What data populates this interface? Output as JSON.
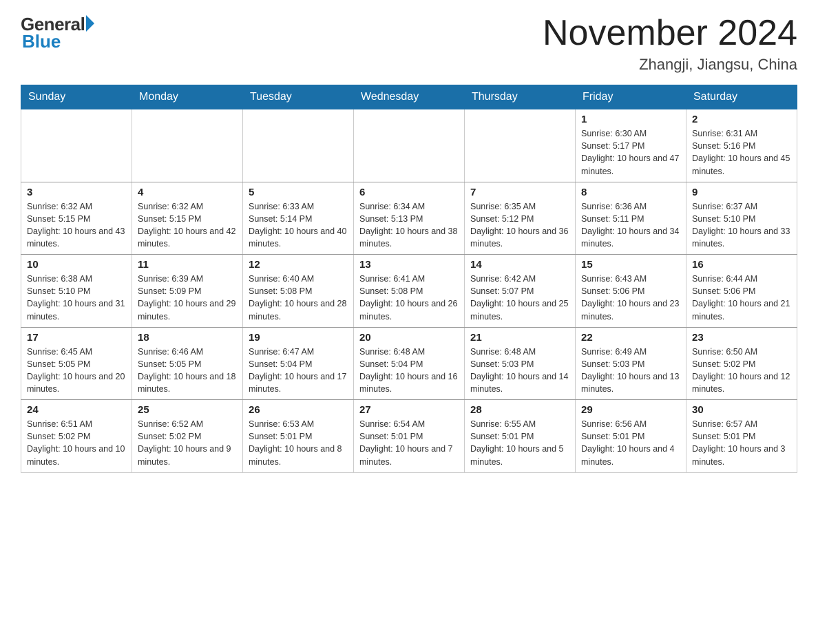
{
  "header": {
    "logo_general": "General",
    "logo_blue": "Blue",
    "month_title": "November 2024",
    "location": "Zhangji, Jiangsu, China"
  },
  "weekdays": [
    "Sunday",
    "Monday",
    "Tuesday",
    "Wednesday",
    "Thursday",
    "Friday",
    "Saturday"
  ],
  "weeks": [
    [
      {
        "day": "",
        "info": ""
      },
      {
        "day": "",
        "info": ""
      },
      {
        "day": "",
        "info": ""
      },
      {
        "day": "",
        "info": ""
      },
      {
        "day": "",
        "info": ""
      },
      {
        "day": "1",
        "info": "Sunrise: 6:30 AM\nSunset: 5:17 PM\nDaylight: 10 hours and 47 minutes."
      },
      {
        "day": "2",
        "info": "Sunrise: 6:31 AM\nSunset: 5:16 PM\nDaylight: 10 hours and 45 minutes."
      }
    ],
    [
      {
        "day": "3",
        "info": "Sunrise: 6:32 AM\nSunset: 5:15 PM\nDaylight: 10 hours and 43 minutes."
      },
      {
        "day": "4",
        "info": "Sunrise: 6:32 AM\nSunset: 5:15 PM\nDaylight: 10 hours and 42 minutes."
      },
      {
        "day": "5",
        "info": "Sunrise: 6:33 AM\nSunset: 5:14 PM\nDaylight: 10 hours and 40 minutes."
      },
      {
        "day": "6",
        "info": "Sunrise: 6:34 AM\nSunset: 5:13 PM\nDaylight: 10 hours and 38 minutes."
      },
      {
        "day": "7",
        "info": "Sunrise: 6:35 AM\nSunset: 5:12 PM\nDaylight: 10 hours and 36 minutes."
      },
      {
        "day": "8",
        "info": "Sunrise: 6:36 AM\nSunset: 5:11 PM\nDaylight: 10 hours and 34 minutes."
      },
      {
        "day": "9",
        "info": "Sunrise: 6:37 AM\nSunset: 5:10 PM\nDaylight: 10 hours and 33 minutes."
      }
    ],
    [
      {
        "day": "10",
        "info": "Sunrise: 6:38 AM\nSunset: 5:10 PM\nDaylight: 10 hours and 31 minutes."
      },
      {
        "day": "11",
        "info": "Sunrise: 6:39 AM\nSunset: 5:09 PM\nDaylight: 10 hours and 29 minutes."
      },
      {
        "day": "12",
        "info": "Sunrise: 6:40 AM\nSunset: 5:08 PM\nDaylight: 10 hours and 28 minutes."
      },
      {
        "day": "13",
        "info": "Sunrise: 6:41 AM\nSunset: 5:08 PM\nDaylight: 10 hours and 26 minutes."
      },
      {
        "day": "14",
        "info": "Sunrise: 6:42 AM\nSunset: 5:07 PM\nDaylight: 10 hours and 25 minutes."
      },
      {
        "day": "15",
        "info": "Sunrise: 6:43 AM\nSunset: 5:06 PM\nDaylight: 10 hours and 23 minutes."
      },
      {
        "day": "16",
        "info": "Sunrise: 6:44 AM\nSunset: 5:06 PM\nDaylight: 10 hours and 21 minutes."
      }
    ],
    [
      {
        "day": "17",
        "info": "Sunrise: 6:45 AM\nSunset: 5:05 PM\nDaylight: 10 hours and 20 minutes."
      },
      {
        "day": "18",
        "info": "Sunrise: 6:46 AM\nSunset: 5:05 PM\nDaylight: 10 hours and 18 minutes."
      },
      {
        "day": "19",
        "info": "Sunrise: 6:47 AM\nSunset: 5:04 PM\nDaylight: 10 hours and 17 minutes."
      },
      {
        "day": "20",
        "info": "Sunrise: 6:48 AM\nSunset: 5:04 PM\nDaylight: 10 hours and 16 minutes."
      },
      {
        "day": "21",
        "info": "Sunrise: 6:48 AM\nSunset: 5:03 PM\nDaylight: 10 hours and 14 minutes."
      },
      {
        "day": "22",
        "info": "Sunrise: 6:49 AM\nSunset: 5:03 PM\nDaylight: 10 hours and 13 minutes."
      },
      {
        "day": "23",
        "info": "Sunrise: 6:50 AM\nSunset: 5:02 PM\nDaylight: 10 hours and 12 minutes."
      }
    ],
    [
      {
        "day": "24",
        "info": "Sunrise: 6:51 AM\nSunset: 5:02 PM\nDaylight: 10 hours and 10 minutes."
      },
      {
        "day": "25",
        "info": "Sunrise: 6:52 AM\nSunset: 5:02 PM\nDaylight: 10 hours and 9 minutes."
      },
      {
        "day": "26",
        "info": "Sunrise: 6:53 AM\nSunset: 5:01 PM\nDaylight: 10 hours and 8 minutes."
      },
      {
        "day": "27",
        "info": "Sunrise: 6:54 AM\nSunset: 5:01 PM\nDaylight: 10 hours and 7 minutes."
      },
      {
        "day": "28",
        "info": "Sunrise: 6:55 AM\nSunset: 5:01 PM\nDaylight: 10 hours and 5 minutes."
      },
      {
        "day": "29",
        "info": "Sunrise: 6:56 AM\nSunset: 5:01 PM\nDaylight: 10 hours and 4 minutes."
      },
      {
        "day": "30",
        "info": "Sunrise: 6:57 AM\nSunset: 5:01 PM\nDaylight: 10 hours and 3 minutes."
      }
    ]
  ]
}
